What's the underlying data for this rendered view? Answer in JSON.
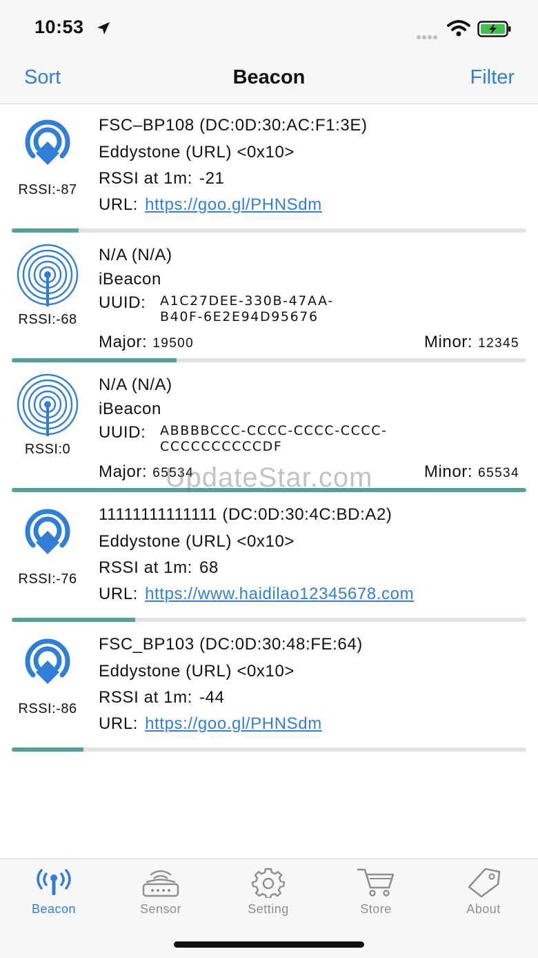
{
  "status": {
    "time": "10:53"
  },
  "nav": {
    "left": "Sort",
    "title": "Beacon",
    "right": "Filter"
  },
  "beacons": [
    {
      "type": "eddystone",
      "rssi": "RSSI:-87",
      "name": "FSC–BP108  (DC:0D:30:AC:F1:3E)",
      "frame": "Eddystone  (URL)  <0x10>",
      "rssi1m_label": "RSSI at 1m:",
      "rssi1m": "-21",
      "url_label": "URL:",
      "url": "https://goo.gl/PHNSdm",
      "signal": 0.13
    },
    {
      "type": "ibeacon",
      "rssi": "RSSI:-68",
      "name": "N/A  (N/A)",
      "frame": "iBeacon",
      "uuid_label": "UUID:",
      "uuid1": "A1C27DEE-330B-47AA-",
      "uuid2": "B40F-6E2E94D95676",
      "major_label": "Major:",
      "major": "19500",
      "minor_label": "Minor:",
      "minor": "12345",
      "signal": 0.32
    },
    {
      "type": "ibeacon",
      "rssi": "RSSI:0",
      "name": "N/A  (N/A)",
      "frame": "iBeacon",
      "uuid_label": "UUID:",
      "uuid1": "ABBBBCCC-CCCC-CCCC-CCCC-",
      "uuid2": "CCCCCCCCCCDF",
      "major_label": "Major:",
      "major": "65534",
      "minor_label": "Minor:",
      "minor": "65534",
      "signal": 1.0
    },
    {
      "type": "eddystone",
      "rssi": "RSSI:-76",
      "name": "11111111111111  (DC:0D:30:4C:BD:A2)",
      "frame": "Eddystone  (URL)  <0x10>",
      "rssi1m_label": "RSSI at 1m:",
      "rssi1m": "68",
      "url_label": "URL:",
      "url": "https://www.haidilao12345678.com",
      "signal": 0.24
    },
    {
      "type": "eddystone",
      "rssi": "RSSI:-86",
      "name": "FSC_BP103  (DC:0D:30:48:FE:64)",
      "frame": "Eddystone  (URL)  <0x10>",
      "rssi1m_label": "RSSI at 1m:",
      "rssi1m": "-44",
      "url_label": "URL:",
      "url": "https://goo.gl/PHNSdm",
      "signal": 0.14
    }
  ],
  "watermark": "UpdateStar.com",
  "tabs": [
    {
      "label": "Beacon",
      "icon": "antenna-icon",
      "active": true
    },
    {
      "label": "Sensor",
      "icon": "router-icon",
      "active": false
    },
    {
      "label": "Setting",
      "icon": "gear-icon",
      "active": false
    },
    {
      "label": "Store",
      "icon": "cart-icon",
      "active": false
    },
    {
      "label": "About",
      "icon": "tag-icon",
      "active": false
    }
  ],
  "colors": {
    "accent": "#2f7fd9",
    "signal": "#4fa39a",
    "track": "#e3e3e3",
    "inactive": "#8e8e93"
  }
}
